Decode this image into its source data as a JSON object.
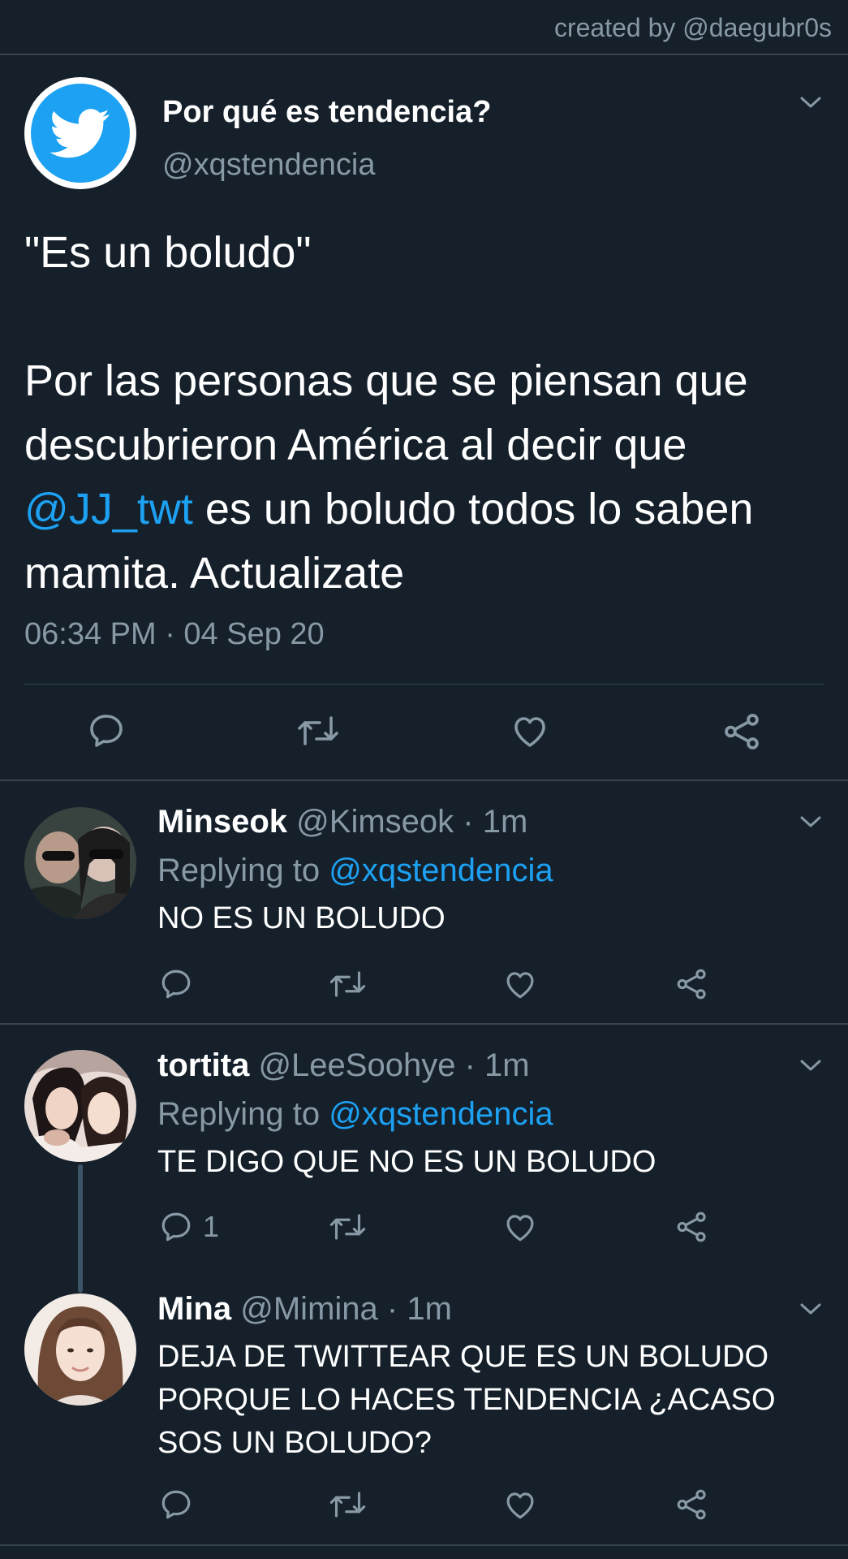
{
  "credit": "created by @daegubr0s",
  "main_tweet": {
    "name": "Por qué es tendencia?",
    "handle": "@xqstendencia",
    "quote": "\"Es un boludo\"",
    "text_before": "Por las personas que se piensan que descubrieron América al decir que ",
    "mention": "@JJ_twt",
    "text_after": " es un boludo todos lo saben mamita. Actualizate",
    "timestamp": "06:34 PM · 04 Sep 20"
  },
  "replies": [
    {
      "name": "Minseok",
      "handle": "@Kimseok",
      "time": "· 1m",
      "replying_label": "Replying to",
      "replying_to": "@xqstendencia",
      "text": "NO ES UN BOLUDO",
      "reply_count": ""
    },
    {
      "name": "tortita",
      "handle": "@LeeSoohye",
      "time": "· 1m",
      "replying_label": "Replying to",
      "replying_to": "@xqstendencia",
      "text": "TE DIGO QUE NO ES UN BOLUDO",
      "reply_count": "1"
    },
    {
      "name": "Mina",
      "handle": "@Mimina",
      "time": "· 1m",
      "text": "DEJA DE TWITTEAR QUE ES UN BOLUDO PORQUE LO HACES TENDENCIA ¿ACASO SOS UN BOLUDO?",
      "reply_count": ""
    }
  ],
  "icons": [
    "twitter-bird-icon",
    "chevron-down-icon",
    "reply-icon",
    "retweet-icon",
    "like-icon",
    "share-icon"
  ],
  "colors": {
    "background": "#15202b",
    "accent": "#1da1f2",
    "secondary_text": "#8899a6",
    "divider": "#38444d"
  }
}
